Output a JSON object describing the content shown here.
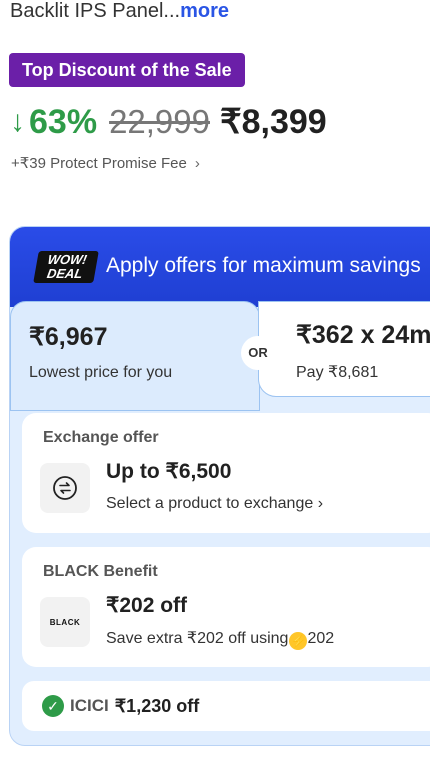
{
  "product": {
    "description": "Backlit IPS Panel...",
    "more_label": "more"
  },
  "sale_tag": "Top Discount of the Sale",
  "pricing": {
    "discount": "63%",
    "mrp": "22,999",
    "final_price": "₹8,399",
    "fee_text": "+₹39 Protect Promise Fee"
  },
  "offers": {
    "header_badge_top": "WOW!",
    "header_badge_bottom": "DEAL",
    "header_title": "Apply offers for maximum savings",
    "lowest_price": "₹6,967",
    "lowest_price_label": "Lowest price for you",
    "or_label": "OR",
    "emi_amount": "₹362 x 24m",
    "emi_pay": "Pay ₹8,681",
    "exchange": {
      "title": "Exchange offer",
      "amount": "Up to ₹6,500",
      "subtitle": "Select a product to exchange"
    },
    "black": {
      "title": "BLACK Benefit",
      "logo": "BLACK",
      "amount": "₹202 off",
      "subtitle": "Save extra ₹202 off using",
      "coins": "202"
    },
    "icici": {
      "bank": "ICICI",
      "amount": "₹1,230 off"
    }
  },
  "colors": {
    "discount_green": "#2e9b48",
    "sale_purple": "#6b1fa8",
    "link_blue": "#2a55e5",
    "offers_header_blue": "#2a4ce8"
  }
}
